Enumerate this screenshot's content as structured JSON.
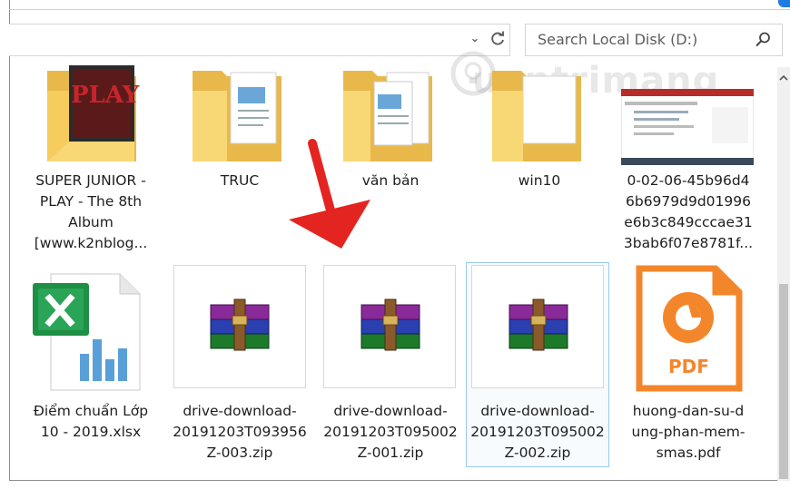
{
  "search": {
    "placeholder": "Search Local Disk (D:)"
  },
  "watermark": {
    "text": "uantrimang"
  },
  "files": [
    {
      "name": "SUPER JUNIOR -\nPLAY - The 8th\nAlbum\n[www.k2nblog..."
    },
    {
      "name": "TRUC"
    },
    {
      "name": "văn bản"
    },
    {
      "name": "win10"
    },
    {
      "name": "0-02-06-45b96d4\n6b6979d9d01996\ne6b3c849cccae31\n3bab6f07e8781f..."
    },
    {
      "name": "Điểm chuẩn Lớp\n10 - 2019.xlsx"
    },
    {
      "name": "drive-download-\n20191203T093956\nZ-003.zip"
    },
    {
      "name": "drive-download-\n20191203T095002\nZ-001.zip"
    },
    {
      "name": "drive-download-\n20191203T095002\nZ-002.zip"
    },
    {
      "name": "huong-dan-su-d\nung-phan-mem-\nsmas.pdf"
    }
  ],
  "album_art": {
    "text": "PLAY"
  },
  "pdf_icon": {
    "text": "PDF"
  },
  "colors": {
    "folder": "#f8d775",
    "folder_dark": "#e8b94a",
    "pdf": "#f3862b",
    "arrow": "#e42420",
    "selection": "#99c9ef"
  }
}
